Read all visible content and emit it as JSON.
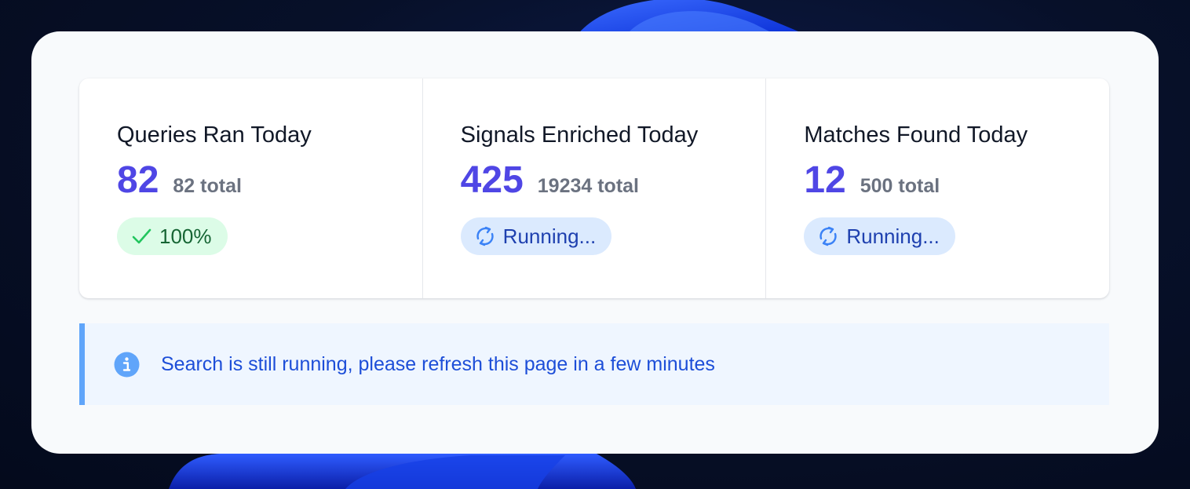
{
  "stats": [
    {
      "title": "Queries Ran Today",
      "value": "82",
      "total": "82 total",
      "badge": {
        "status": "success",
        "icon": "check-icon",
        "label": "100%"
      }
    },
    {
      "title": "Signals Enriched Today",
      "value": "425",
      "total": "19234 total",
      "badge": {
        "status": "running",
        "icon": "refresh-icon",
        "label": "Running..."
      }
    },
    {
      "title": "Matches Found Today",
      "value": "12",
      "total": "500 total",
      "badge": {
        "status": "running",
        "icon": "refresh-icon",
        "label": "Running..."
      }
    }
  ],
  "info_banner": {
    "icon": "info-icon",
    "message": "Search is still running, please refresh this page in a few minutes"
  },
  "colors": {
    "accent_value": "#4f46e5",
    "success_bg": "#dcfce7",
    "success_text": "#166534",
    "running_bg": "#dbeafe",
    "running_text": "#1e40af",
    "info_bg": "#eff6ff",
    "info_border": "#60a5fa",
    "info_text": "#1d4ed8"
  }
}
